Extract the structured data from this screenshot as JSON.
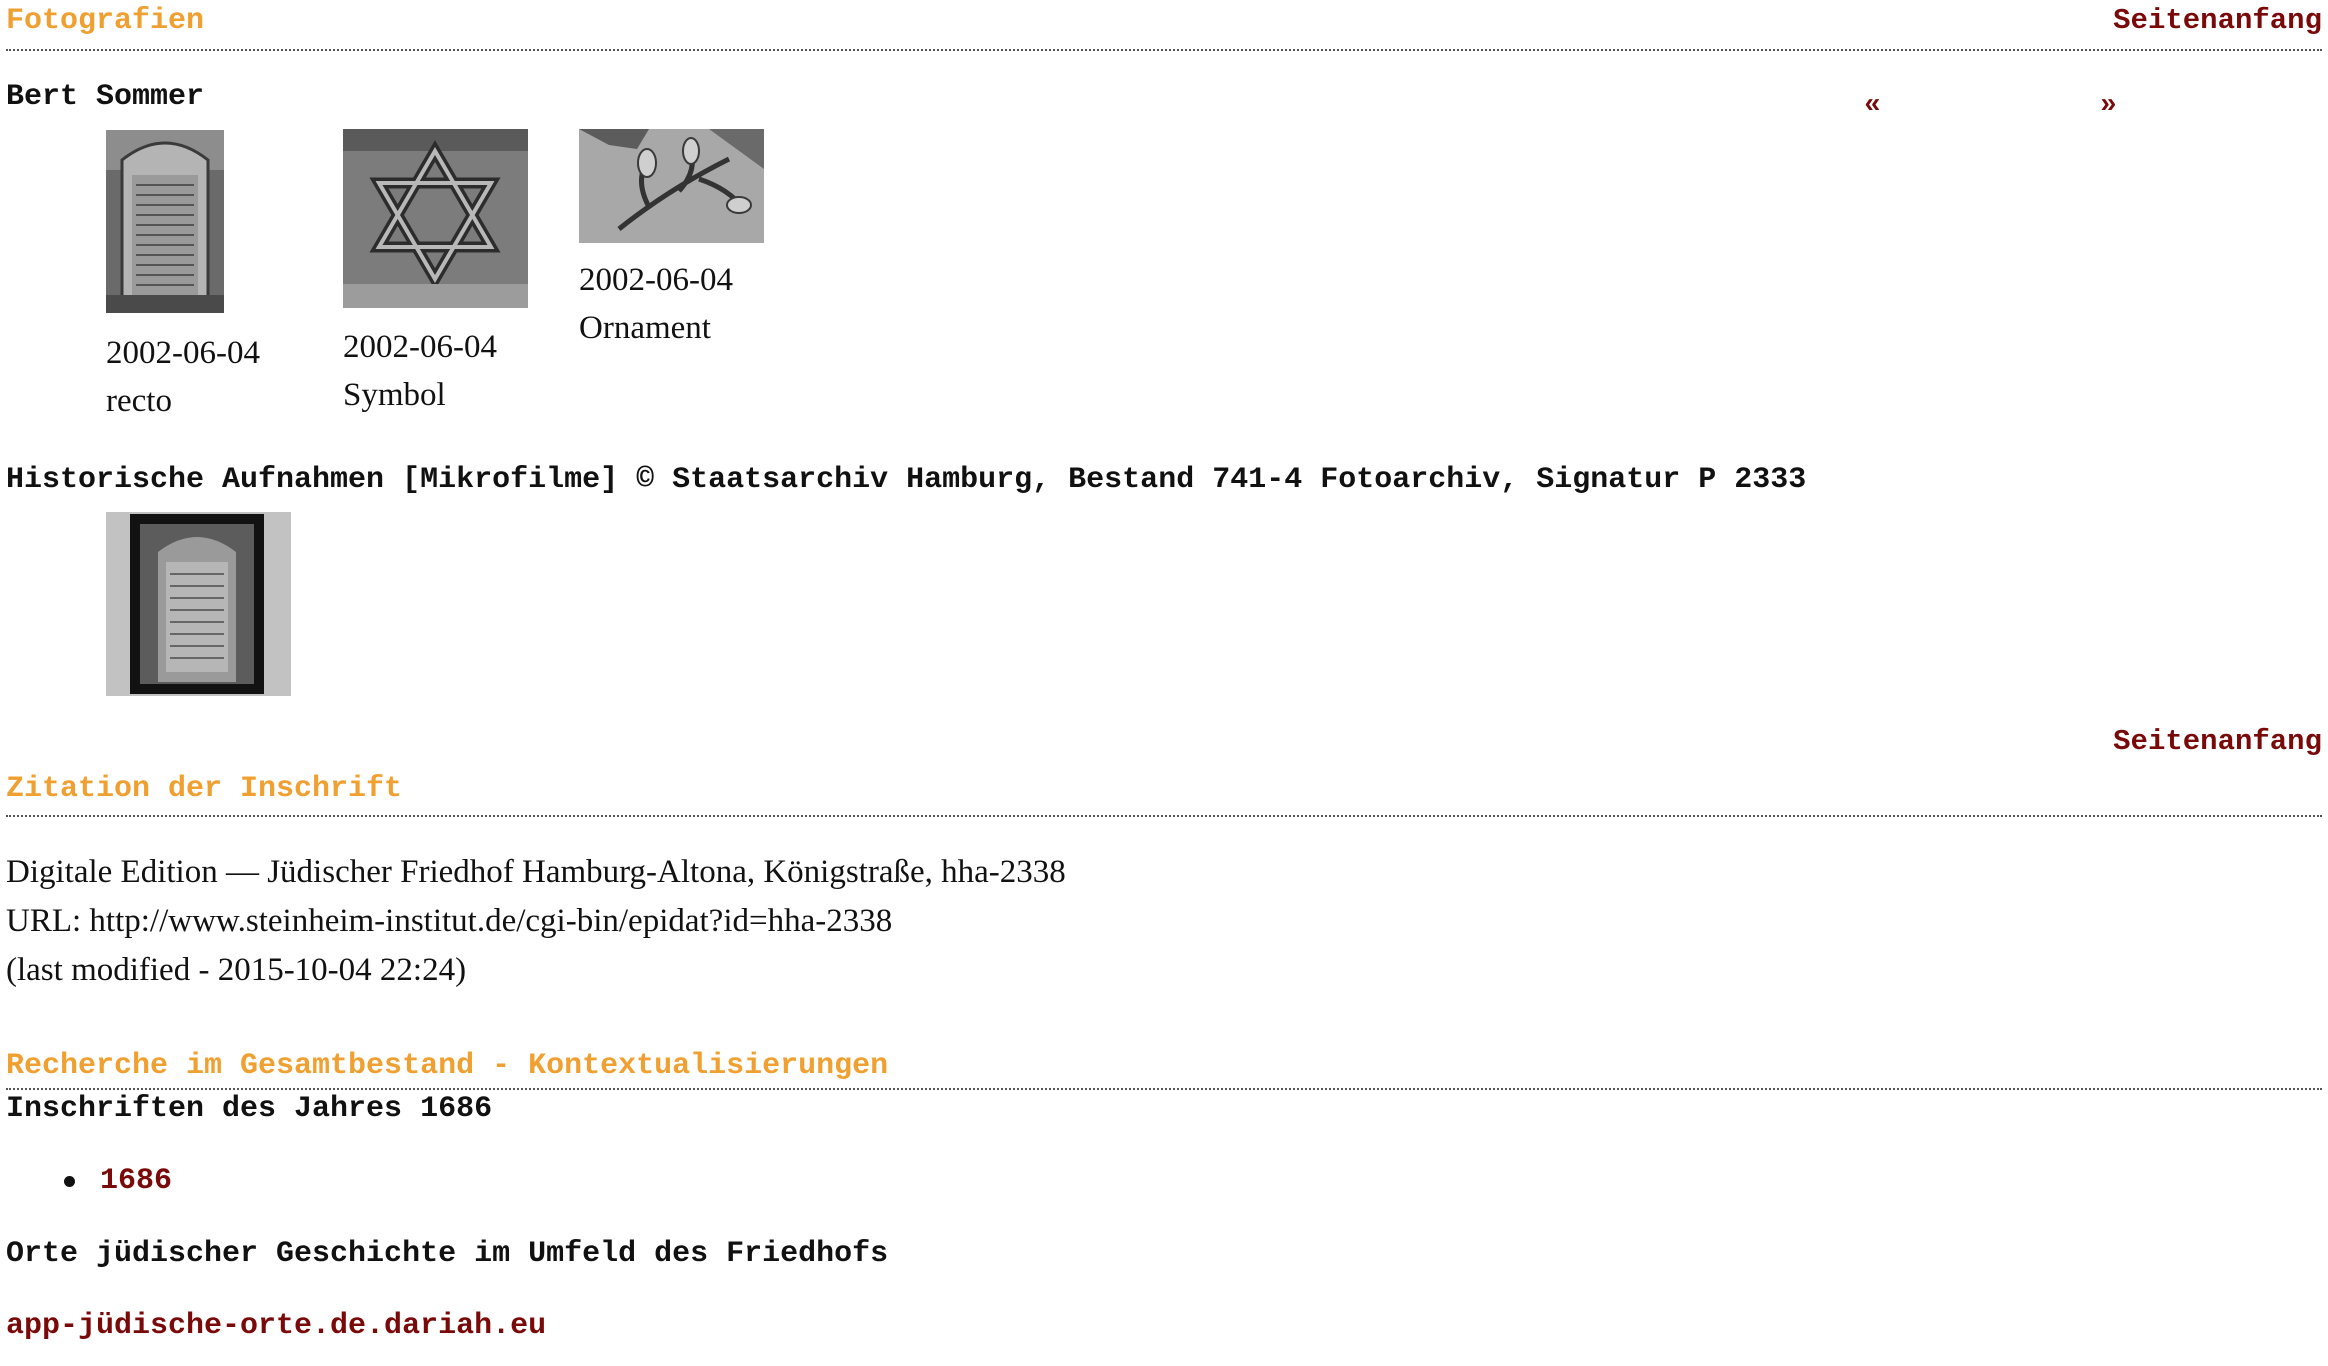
{
  "section_photos": {
    "title": "Fotografien",
    "top_link": "Seitenanfang",
    "subtitle": "Bert Sommer",
    "prev": "«",
    "next": "»",
    "photos": [
      {
        "date": "2002-06-04",
        "caption": "recto"
      },
      {
        "date": "2002-06-04",
        "caption": "Symbol"
      },
      {
        "date": "2002-06-04",
        "caption": "Ornament"
      }
    ],
    "historic_heading": "Historische Aufnahmen [Mikrofilme] © Staatsarchiv Hamburg, Bestand 741-4 Fotoarchiv, Signatur P 2333"
  },
  "section_citation": {
    "top_link": "Seitenanfang",
    "title": "Zitation der Inschrift",
    "line1": "Digitale Edition — Jüdischer Friedhof Hamburg-Altona, Königstraße, hha-2338",
    "line2": "URL: http://www.steinheim-institut.de/cgi-bin/epidat?id=hha-2338",
    "line3": "(last modified - 2015-10-04 22:24)"
  },
  "section_research": {
    "title": "Recherche im Gesamtbestand - Kontextualisierungen",
    "year_heading": "Inschriften des Jahres 1686",
    "year_link": "1686",
    "places_heading": "Orte jüdischer Geschichte im Umfeld des Friedhofs",
    "places_link": "app-jüdische-orte.de.dariah.eu"
  },
  "colors": {
    "section_title": "#f0a030",
    "link": "#7a0a0a",
    "text": "#111111"
  }
}
